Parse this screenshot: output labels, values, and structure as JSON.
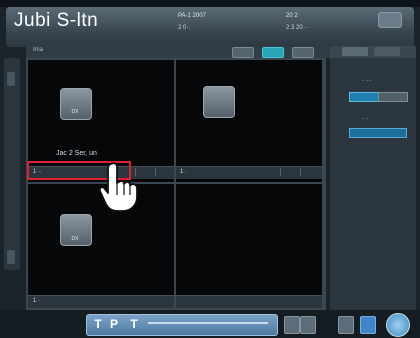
{
  "header": {
    "patient_name": "Jubi S-ltn",
    "patient_id": "PA-1 2007",
    "patient_sub": "2 0··",
    "exam_date": "20  2",
    "exam_sub": "2 3 20 ··"
  },
  "toolbar": {
    "label": "Ima"
  },
  "viewer": {
    "cells": [
      {
        "thumb_label": "DX",
        "caption": "Jac 2  Ser, un",
        "bar_text": "1 ··"
      },
      {
        "thumb_label": "",
        "caption": "",
        "bar_text": "1 ·"
      },
      {
        "thumb_label": "DX",
        "caption": "",
        "bar_text": "1 ·"
      },
      {
        "thumb_label": "",
        "caption": "",
        "bar_text": ""
      }
    ]
  },
  "right_panel": {
    "label1": "·· ···",
    "label2": "·· ·"
  },
  "bottom": {
    "tools": [
      "T",
      "P",
      "T"
    ]
  },
  "colors": {
    "highlight": "#e0202a",
    "accent": "#2aa4b8"
  }
}
